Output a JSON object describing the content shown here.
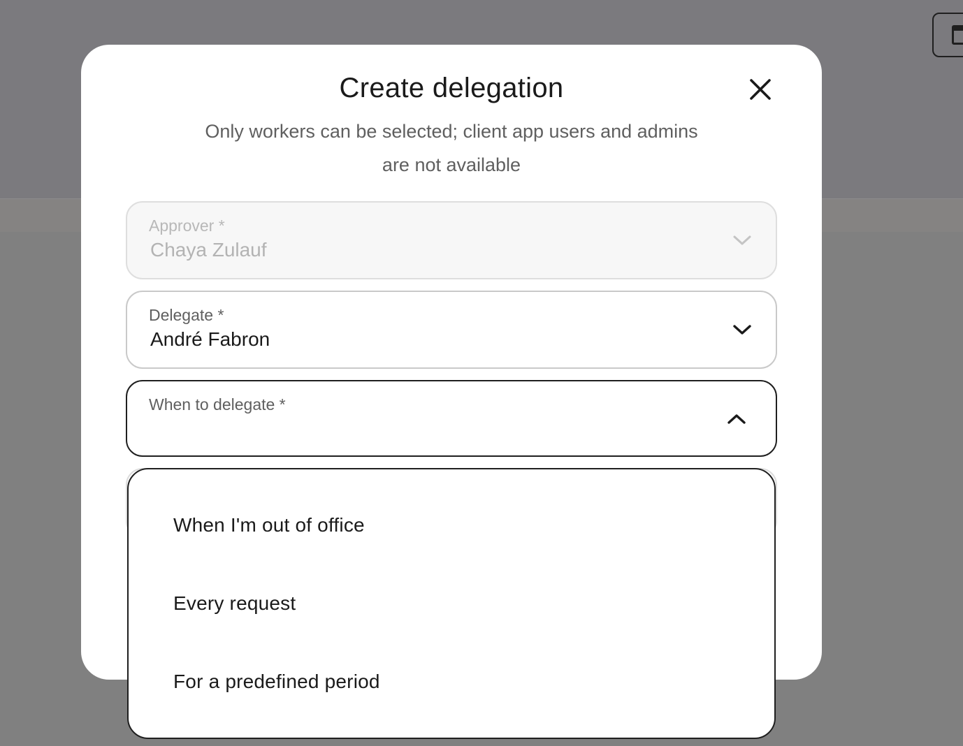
{
  "modal": {
    "title": "Create delegation",
    "subtitle": "Only workers can be selected; client app users and admins are not available",
    "close_icon": "close-icon"
  },
  "fields": {
    "approver": {
      "label": "Approver *",
      "value": "Chaya Zulauf",
      "disabled": true,
      "icon": "chevron-down-icon"
    },
    "delegate": {
      "label": "Delegate *",
      "value": "André Fabron",
      "icon": "chevron-down-icon"
    },
    "when": {
      "label": "When to delegate *",
      "value": "",
      "expanded": true,
      "icon": "chevron-up-icon"
    }
  },
  "dropdown": {
    "options": [
      "When I'm out of office",
      "Every request",
      "For a predefined period"
    ]
  },
  "colors": {
    "backdrop": "#7b7a7e",
    "modal_bg": "#ffffff",
    "text_primary": "#1a1a1a",
    "text_secondary": "#5f5f5f",
    "border": "#c9c9c9",
    "focus_border": "#1f1f1f"
  }
}
